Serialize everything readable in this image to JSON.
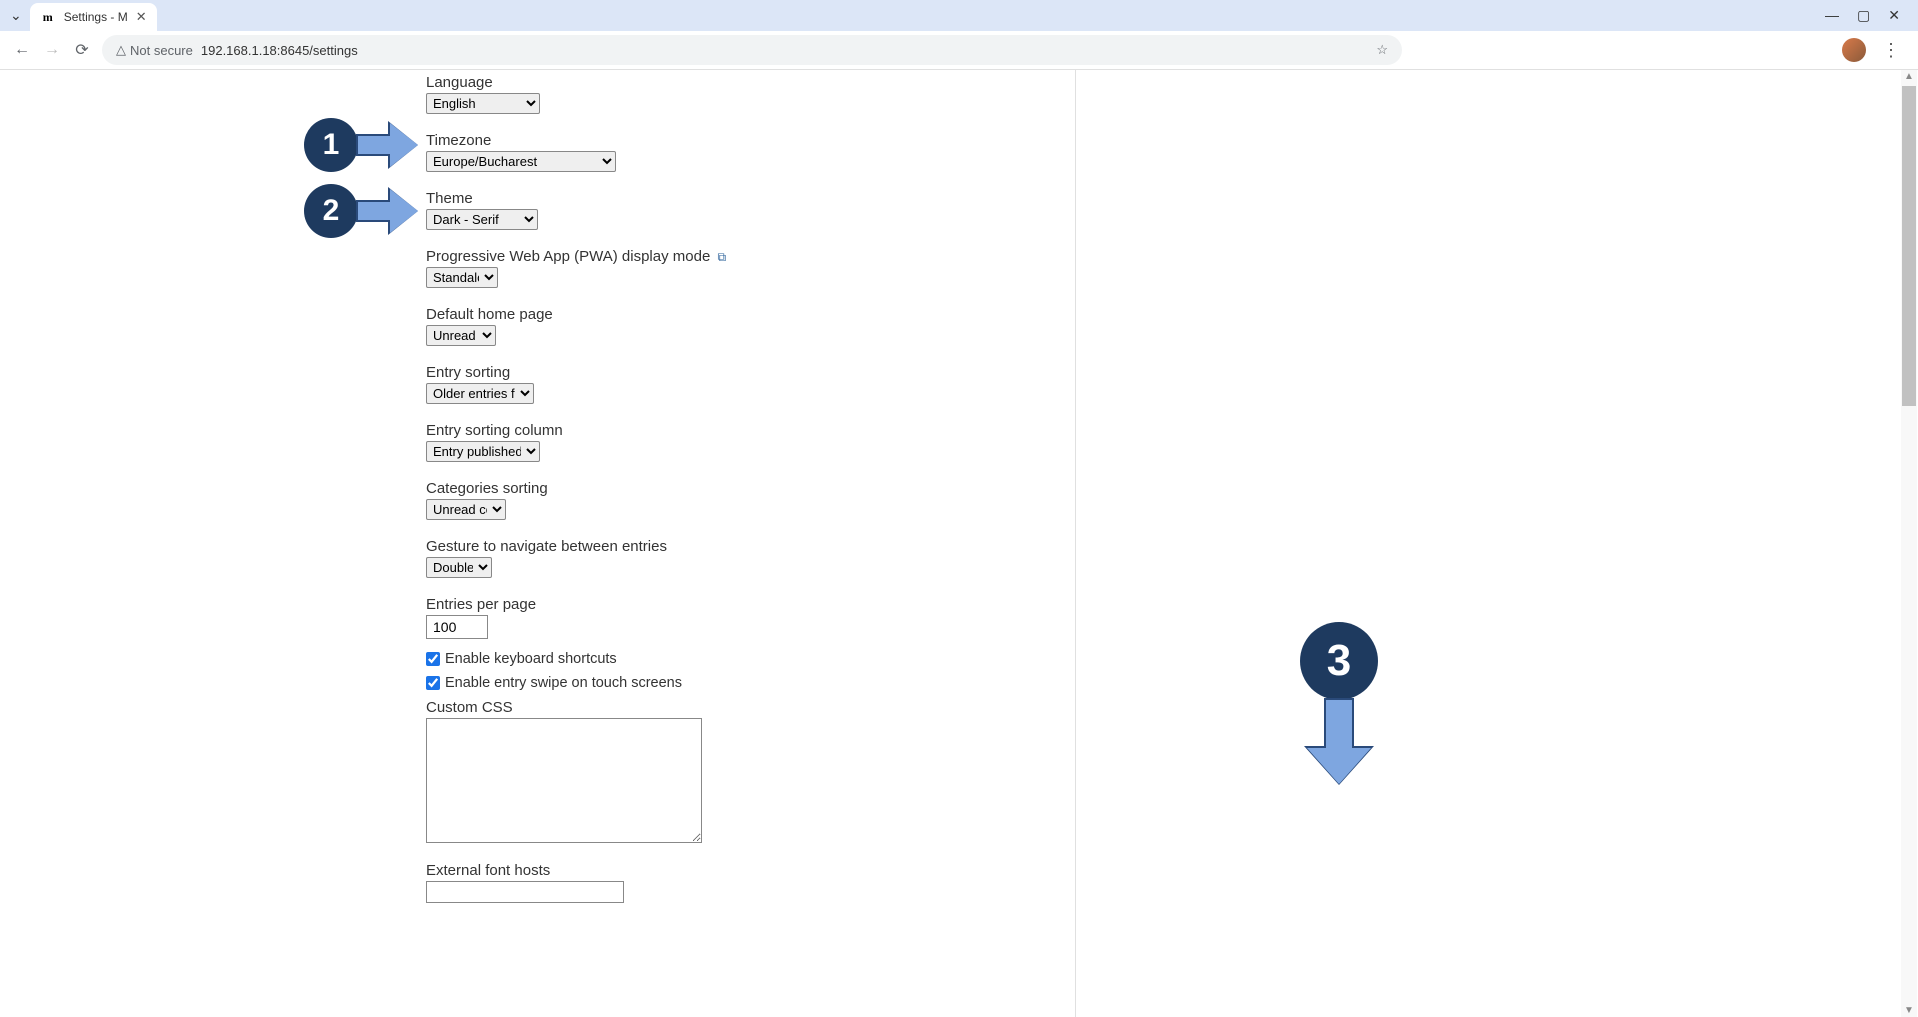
{
  "browser": {
    "tab_title": "Settings - M",
    "url": "192.168.1.18:8645/settings",
    "security": "Not secure"
  },
  "fields": {
    "language": {
      "label": "Language",
      "value": "English"
    },
    "timezone": {
      "label": "Timezone",
      "value": "Europe/Bucharest"
    },
    "theme": {
      "label": "Theme",
      "value": "Dark - Serif"
    },
    "pwa": {
      "label": "Progressive Web App (PWA) display mode",
      "value": "Standalone"
    },
    "homepage": {
      "label": "Default home page",
      "value": "Unread"
    },
    "entry_sorting": {
      "label": "Entry sorting",
      "value": "Older entries first"
    },
    "entry_sorting_column": {
      "label": "Entry sorting column",
      "value": "Entry published time"
    },
    "categories_sorting": {
      "label": "Categories sorting",
      "value": "Unread count"
    },
    "gesture": {
      "label": "Gesture to navigate between entries",
      "value": "Double tap"
    },
    "entries_per_page": {
      "label": "Entries per page",
      "value": "100"
    },
    "kb_shortcuts": {
      "label": "Enable keyboard shortcuts",
      "checked": true
    },
    "entry_swipe": {
      "label": "Enable entry swipe on touch screens",
      "checked": true
    },
    "custom_css": {
      "label": "Custom CSS",
      "value": ""
    },
    "external_fonts": {
      "label": "External font hosts",
      "value": ""
    }
  },
  "annotations": {
    "a1": "1",
    "a2": "2",
    "a3": "3"
  }
}
